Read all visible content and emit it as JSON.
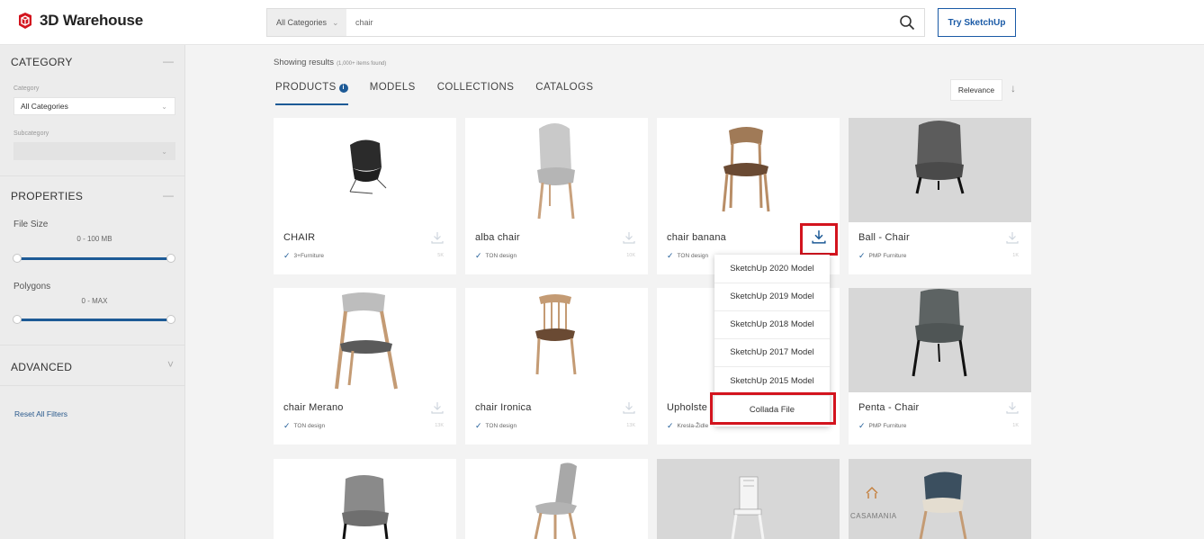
{
  "header": {
    "logo_text": "3D Warehouse",
    "category_select": "All Categories",
    "search_value": "chair",
    "try_button": "Try SketchUp"
  },
  "sidebar": {
    "category_section": "CATEGORY",
    "category_label": "Category",
    "category_value": "All Categories",
    "subcategory_label": "Subcategory",
    "properties_section": "PROPERTIES",
    "file_size_label": "File Size",
    "file_size_range": "0 - 100 MB",
    "polygons_label": "Polygons",
    "polygons_range": "0 - MAX",
    "advanced_section": "ADVANCED",
    "reset_link": "Reset All Filters",
    "collapse_glyph": "—",
    "expand_glyph": "˅"
  },
  "main": {
    "showing": "Showing results",
    "showing_count": "(1,000+ items found)",
    "tabs": [
      "PRODUCTS",
      "MODELS",
      "COLLECTIONS",
      "CATALOGS"
    ],
    "info_badge": "i",
    "sort_label": "Relevance",
    "sort_arrow": "↓"
  },
  "cards": [
    {
      "title": "CHAIR",
      "author": "3+Furniture",
      "count": "5K"
    },
    {
      "title": "alba chair",
      "author": "TON design",
      "count": "10K"
    },
    {
      "title": "chair banana",
      "author": "TON design",
      "count": ""
    },
    {
      "title": "Ball - Chair",
      "author": "PMP Furniture",
      "count": "1K"
    },
    {
      "title": "chair Merano",
      "author": "TON design",
      "count": "13K"
    },
    {
      "title": "chair Ironica",
      "author": "TON design",
      "count": "13K"
    },
    {
      "title": "Upholste",
      "author": "Kresla-Židle",
      "count": ""
    },
    {
      "title": "Penta - Chair",
      "author": "PMP Furniture",
      "count": "1K"
    }
  ],
  "download_menu": [
    "SketchUp 2020 Model",
    "SketchUp 2019 Model",
    "SketchUp 2018 Model",
    "SketchUp 2017 Model",
    "SketchUp 2015 Model",
    "Collada File"
  ],
  "brand_logo": "CASAMANIA",
  "colors": {
    "accent": "#1d5a96",
    "highlight": "#d3141e",
    "logo_red": "#d3141e"
  }
}
